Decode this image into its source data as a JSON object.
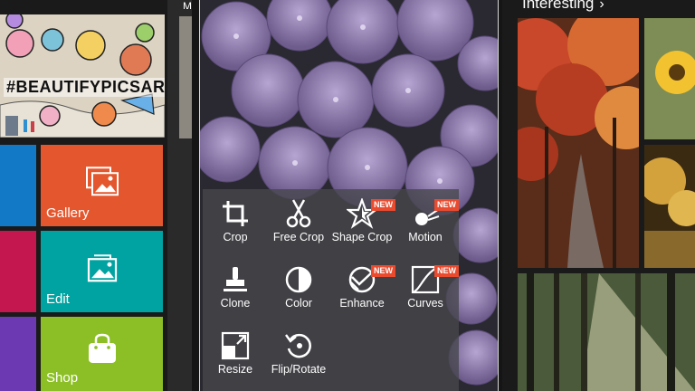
{
  "left": {
    "banner_text": "#BEAUTIFYPICSART",
    "tiles": [
      {
        "label": "Gallery",
        "color": "#e4572e"
      },
      {
        "label": "Edit",
        "color": "#00a3a1"
      },
      {
        "label": "Shop",
        "color": "#8cbf26"
      }
    ],
    "strip_colors": [
      "#1279c6",
      "#c4174f",
      "#6d39b2"
    ]
  },
  "top_stub": "M",
  "tools": [
    {
      "label": "Crop",
      "icon": "crop-icon",
      "new": false
    },
    {
      "label": "Free Crop",
      "icon": "scissors-icon",
      "new": false
    },
    {
      "label": "Shape Crop",
      "icon": "star-shape-icon",
      "new": true
    },
    {
      "label": "Motion",
      "icon": "motion-icon",
      "new": true
    },
    {
      "label": "Clone",
      "icon": "stamp-icon",
      "new": false
    },
    {
      "label": "Color",
      "icon": "color-contrast-icon",
      "new": false
    },
    {
      "label": "Enhance",
      "icon": "enhance-icon",
      "new": true
    },
    {
      "label": "Curves",
      "icon": "curves-icon",
      "new": true
    },
    {
      "label": "Resize",
      "icon": "resize-icon",
      "new": false
    },
    {
      "label": "Flip/Rotate",
      "icon": "flip-rotate-icon",
      "new": false
    }
  ],
  "badge_text": "NEW",
  "right": {
    "section_title": "Interesting",
    "chevron": "›"
  }
}
